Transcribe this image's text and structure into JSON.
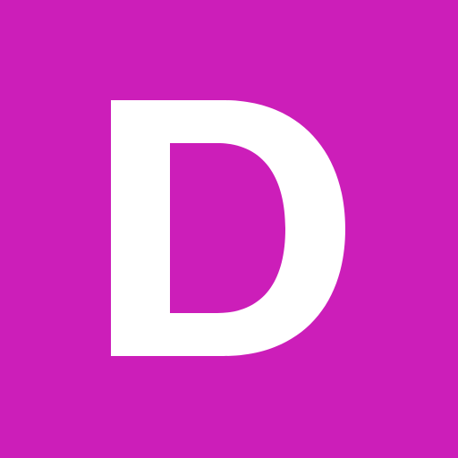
{
  "avatar": {
    "letter": "D",
    "background_color": "#cc1eb9",
    "letter_color": "#ffffff"
  }
}
